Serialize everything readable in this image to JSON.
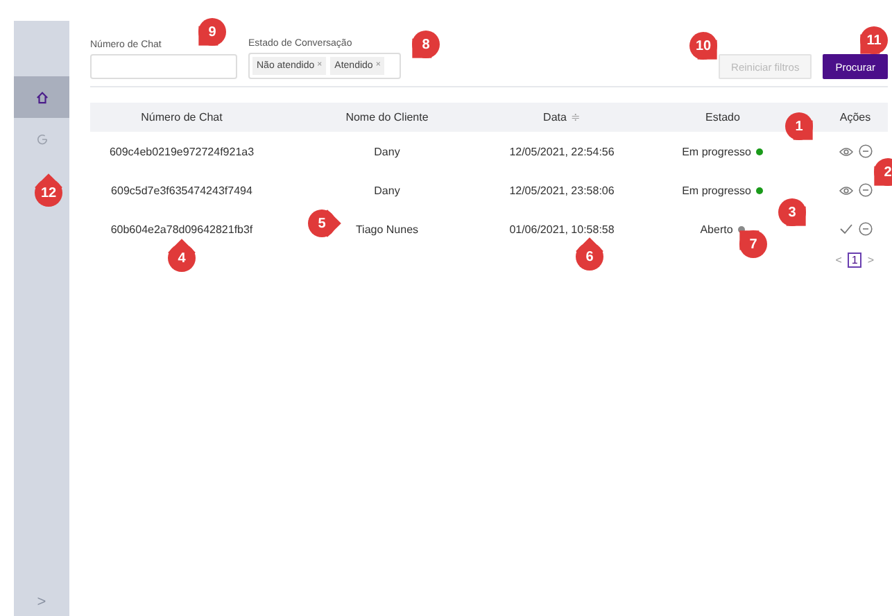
{
  "sidebar": {
    "items": [
      {
        "kind": "home",
        "selected": true
      },
      {
        "kind": "refresh",
        "selected": false
      }
    ],
    "collapse": ">"
  },
  "filters": {
    "chat_number": {
      "label": "Número de Chat"
    },
    "state": {
      "label": "Estado de Conversação",
      "tags": [
        "Não atendido",
        "Atendido"
      ],
      "remove": "×"
    }
  },
  "buttons": [
    {
      "label": "Reiniciar filtros",
      "disabled": true
    },
    {
      "label": "Procurar",
      "disabled": false
    }
  ],
  "table": {
    "columns": [
      "Número de Chat",
      "Nome do Cliente",
      "Data",
      "Estado",
      "Ações"
    ],
    "sort_icon": "≑",
    "rows": [
      {
        "chat": "609c4eb0219e972724f921a3",
        "client": "Dany",
        "date": "12/05/2021, 22:54:56",
        "state": "Em progresso",
        "color": "#1a9a1a",
        "kind": "view"
      },
      {
        "chat": "609c5d7e3f635474243f7494",
        "client": "Dany",
        "date": "12/05/2021, 23:58:06",
        "state": "Em progresso",
        "color": "#1a9a1a",
        "kind": "view"
      },
      {
        "chat": "60b604e2a78d09642821fb3f",
        "client": "Tiago Nunes",
        "date": "01/06/2021, 10:58:58",
        "state": "Aberto",
        "color": "#8a8a8a",
        "kind": "accept"
      }
    ]
  },
  "pagination": {
    "prev": "<",
    "pages": [
      {
        "label": "1",
        "selected": true
      }
    ],
    "next": ">"
  },
  "callouts": [
    "1",
    "2",
    "3",
    "4",
    "5",
    "6",
    "7",
    "8",
    "9",
    "10",
    "11",
    "12"
  ]
}
